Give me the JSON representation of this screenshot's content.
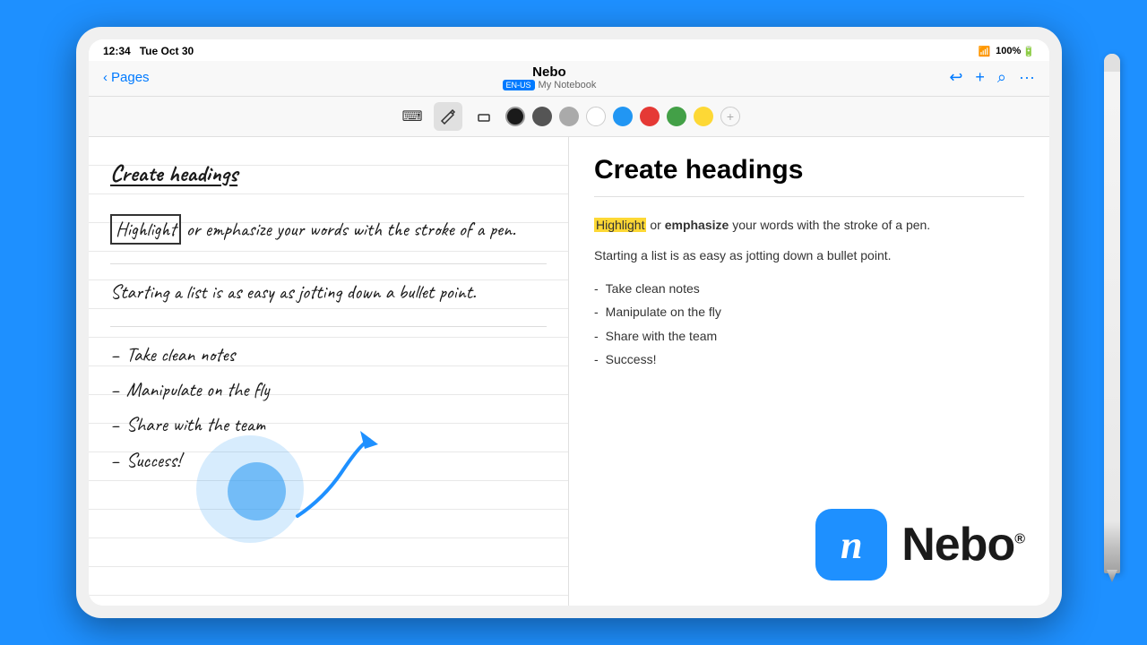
{
  "scene": {
    "background_color": "#1E90FF"
  },
  "status_bar": {
    "time": "12:34",
    "day": "Tue Oct 30",
    "wifi": "WiFi",
    "battery": "100%"
  },
  "nav": {
    "back_label": "Pages",
    "title": "Nebo",
    "subtitle": "My Notebook",
    "lang_badge": "EN-US",
    "undo_icon": "↩",
    "add_icon": "+",
    "search_icon": "⌕",
    "more_icon": "···"
  },
  "toolbar": {
    "keyboard_icon": "⌨",
    "pen_icon": "✏",
    "eraser_icon": "◻",
    "colors": [
      "black",
      "dark-gray",
      "light-gray",
      "white",
      "blue",
      "red",
      "green",
      "yellow"
    ],
    "add_color": "+"
  },
  "left_panel": {
    "heading": "Create headings",
    "paragraph1_part1": "Highlight",
    "paragraph1_part2": " or emphasize your words with the stroke of a pen.",
    "paragraph2": "Starting a list is as easy as jotting down a bullet point.",
    "bullets": [
      "Take clean notes",
      "Manipulate on the fly",
      "Share with the team",
      "Success!"
    ]
  },
  "right_panel": {
    "heading": "Create headings",
    "text1_highlight": "Highlight",
    "text1_rest": " or ",
    "text1_bold": "emphasize",
    "text1_end": " your words with the stroke of a pen.",
    "text2": "Starting a list is as easy as jotting down a bullet point.",
    "bullets": [
      "Take clean notes",
      "Manipulate on the fly",
      "Share with the team",
      "Success!"
    ]
  },
  "nebo_brand": {
    "wordmark": "Nebo",
    "registered": "®",
    "logo_letter": "n"
  }
}
